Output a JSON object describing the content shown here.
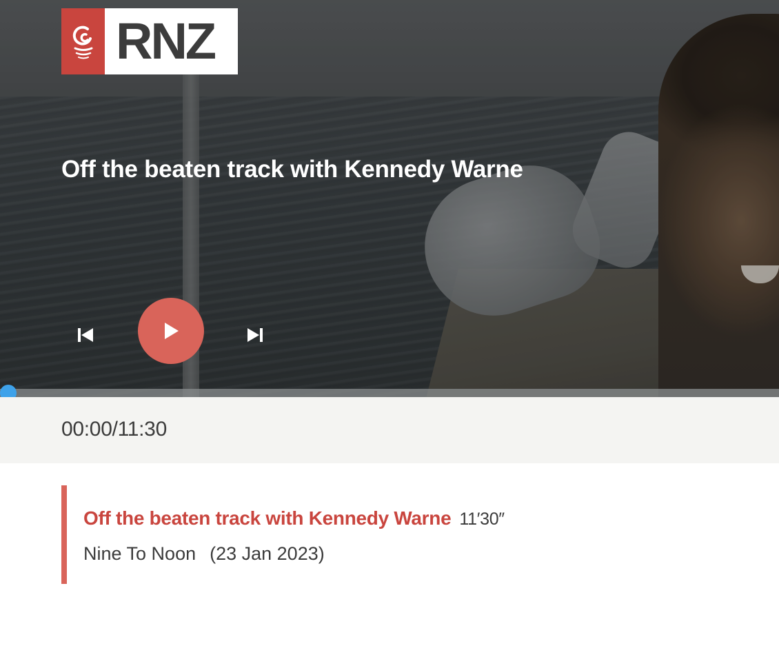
{
  "brand": {
    "logo_text": "RNZ",
    "accent_color": "#c9453e",
    "play_color": "#d9645a",
    "progress_color": "#3ea2ea"
  },
  "player": {
    "title": "Off the beaten track with Kennedy Warne",
    "icons": {
      "previous": "skip-previous-icon",
      "play": "play-icon",
      "next": "skip-next-icon"
    },
    "progress_fraction": 0.0,
    "time_display": "00:00/11:30"
  },
  "playlist": [
    {
      "title": "Off the beaten track with Kennedy Warne",
      "duration": "11′30″",
      "programme": "Nine To Noon",
      "date": "(23 Jan 2023)"
    }
  ]
}
